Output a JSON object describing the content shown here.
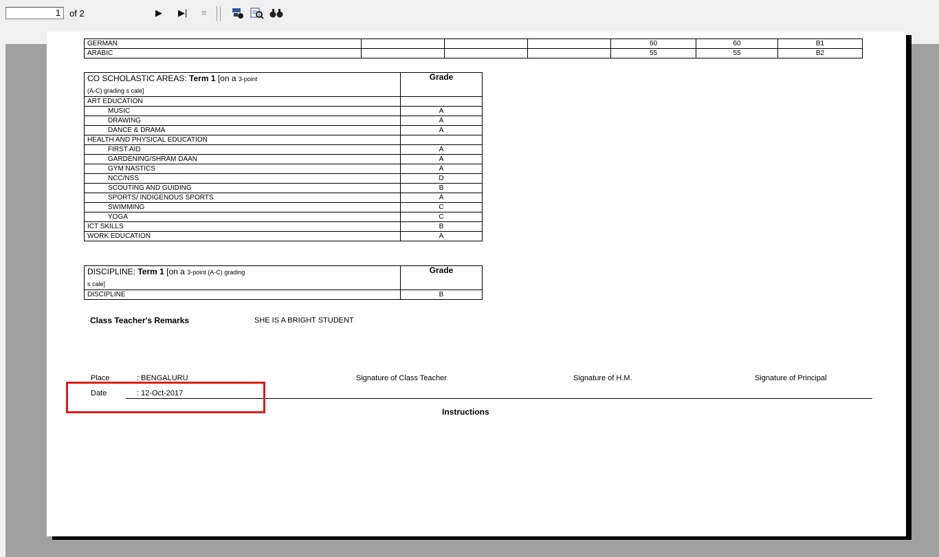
{
  "toolbar": {
    "page_number": "1",
    "page_of": "of 2",
    "icons": [
      "play-next-icon",
      "last-page-icon",
      "stop-icon",
      "group-tree-icon",
      "zoom-icon",
      "search-binoculars-icon"
    ]
  },
  "report": {
    "subjects": [
      {
        "name": "GERMAN",
        "c5": "60",
        "c6": "60",
        "c7": "B1"
      },
      {
        "name": "ARABIC",
        "c5": "55",
        "c6": "55",
        "c7": "B2"
      }
    ],
    "co_scholastic": {
      "header_bold_prefix": "CO SCHOLASTIC AREAS: ",
      "header_bold_term": "Term 1",
      "header_rest_large": " [on a ",
      "header_rest_small": "3-point",
      "header_line2": "(A-C) grading s cale]",
      "grade_header": "Grade",
      "rows": [
        {
          "label": "ART EDUCATION",
          "grade": "",
          "indent": false
        },
        {
          "label": "MUSIC",
          "grade": "A",
          "indent": true
        },
        {
          "label": "DRAWING",
          "grade": "A",
          "indent": true
        },
        {
          "label": "DANCE & DRAMA",
          "grade": "A",
          "indent": true
        },
        {
          "label": "HEALTH AND PHYSICAL EDUCATION",
          "grade": "",
          "indent": false
        },
        {
          "label": "FIRST AID",
          "grade": "A",
          "indent": true
        },
        {
          "label": "GARDENING/SHRAM DAAN",
          "grade": "A",
          "indent": true
        },
        {
          "label": "GYM NASTICS",
          "grade": "A",
          "indent": true
        },
        {
          "label": "NCC/NSS",
          "grade": "D",
          "indent": true
        },
        {
          "label": "SCOUTING AND GUIDING",
          "grade": "B",
          "indent": true
        },
        {
          "label": "SPORTS/ INDIGENOUS SPORTS",
          "grade": "A",
          "indent": true
        },
        {
          "label": "SWIMMING",
          "grade": "C",
          "indent": true
        },
        {
          "label": "YOGA",
          "grade": "C",
          "indent": true
        },
        {
          "label": "ICT SKILLS",
          "grade": "B",
          "indent": false
        },
        {
          "label": "WORK EDUCATION",
          "grade": "A",
          "indent": false
        }
      ]
    },
    "discipline": {
      "header_prefix": "DISCIPLINE: ",
      "header_term": "Term 1",
      "header_rest_large": " [on a ",
      "header_rest_small": "3-point (A-C) grading",
      "header_line2": "s cale]",
      "grade_header": "Grade",
      "row_label": "DISCIPLINE",
      "row_grade": "B"
    },
    "remarks_label": "Class Teacher's Remarks",
    "remarks_value": "SHE IS A BRIGHT STUDENT",
    "place_label": "Place",
    "place_value": ": BENGALURU",
    "date_label": "Date",
    "date_value": ": 12-Oct-2017",
    "sig_teacher": "Signature of Class Teacher",
    "sig_hm": "Signature of H.M.",
    "sig_principal": "Signature of Principal",
    "instructions": "Instructions"
  },
  "colors": {
    "highlight_box": "#e01c1c",
    "background": "#a0a0a0"
  }
}
